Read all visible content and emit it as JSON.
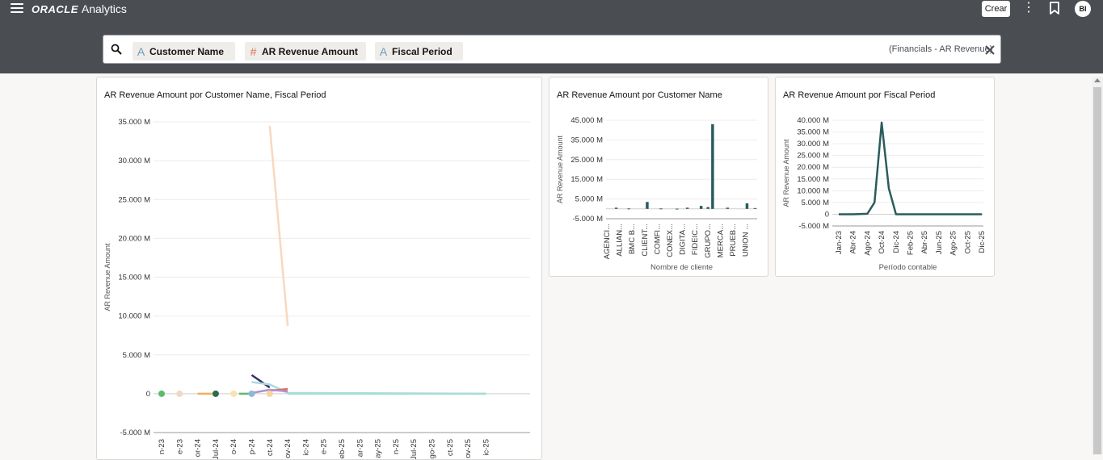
{
  "header": {
    "brand_oracle": "ORACLE",
    "brand_product": "Analytics",
    "create_label": "Crear",
    "kebab_symbol": "⋮",
    "avatar_initials": "BI"
  },
  "search": {
    "pills": [
      {
        "type_symbol": "A",
        "label": "Customer Name"
      },
      {
        "type_symbol": "#",
        "label": "AR Revenue Amount"
      },
      {
        "type_symbol": "A",
        "label": "Fiscal Period"
      }
    ],
    "subject_area": "(Financials - AR Revenue)"
  },
  "chart_data": [
    {
      "type": "line",
      "title": "AR Revenue Amount por Customer Name, Fiscal Period",
      "ylabel": "AR Revenue Amount",
      "xlabel": "",
      "ylim": [
        -5000,
        35000
      ],
      "yticks": [
        {
          "value": -5000,
          "label": "-5.000 M"
        },
        {
          "value": 0,
          "label": "0"
        },
        {
          "value": 5000,
          "label": "5.000 M"
        },
        {
          "value": 10000,
          "label": "10.000 M"
        },
        {
          "value": 15000,
          "label": "15.000 M"
        },
        {
          "value": 20000,
          "label": "20.000 M"
        },
        {
          "value": 25000,
          "label": "25.000 M"
        },
        {
          "value": 30000,
          "label": "30.000 M"
        },
        {
          "value": 35000,
          "label": "35.000 M"
        }
      ],
      "x_tick_labels": [
        "n-23",
        "e-23",
        "or-24",
        "Jul-24",
        "o-24",
        "p-24",
        "ct-24",
        "ov-24",
        "ic-24",
        "e-25",
        "eb-25",
        "ar-25",
        "ay-25",
        "n-25",
        "Jul-25",
        "go-25",
        "ct-25",
        "ov-25",
        "ic-25"
      ],
      "series": [
        {
          "color": "#f9d8c0",
          "x": [
            6,
            7
          ],
          "values": [
            34500,
            8700
          ]
        },
        {
          "color": "#3a2f6b",
          "x": [
            5,
            6
          ],
          "values": [
            2400,
            800
          ]
        },
        {
          "color": "#a8dcd8",
          "x": [
            5,
            6,
            7,
            18
          ],
          "values": [
            1500,
            1200,
            100,
            0
          ]
        },
        {
          "color": "#d9715a",
          "x": [
            6,
            7
          ],
          "values": [
            400,
            600
          ]
        },
        {
          "color": "#b48fd1",
          "x": [
            5,
            6,
            7
          ],
          "values": [
            100,
            500,
            300
          ]
        },
        {
          "color": "#a8dcd8",
          "x": [
            7,
            18
          ],
          "values": [
            0,
            0
          ]
        }
      ],
      "markers": [
        {
          "color": "#5dbb6e",
          "x": 0,
          "value": 0
        },
        {
          "color": "#f0d9c9",
          "x": 1,
          "value": 0
        },
        {
          "color": "#2e6b4a",
          "x": 3,
          "value": 0
        },
        {
          "color": "#f9e2b0",
          "x": 4,
          "value": 0
        },
        {
          "color": "#8fb8d8",
          "x": 5,
          "value": 0
        },
        {
          "color": "#f5d59a",
          "x": 6,
          "value": 0
        }
      ],
      "segments": [
        {
          "color": "#f0b060",
          "x": [
            2,
            2.8
          ],
          "values": [
            0,
            0
          ]
        },
        {
          "color": "#5dbb6e",
          "x": [
            4.3,
            4.9
          ],
          "values": [
            0,
            0
          ]
        }
      ]
    },
    {
      "type": "bar",
      "title": "AR Revenue Amount por Customer Name",
      "ylabel": "AR Revenue Amount",
      "xlabel": "Nombre de cliente",
      "ylim": [
        -5000,
        45000
      ],
      "yticks": [
        {
          "value": -5000,
          "label": "-5.000 M"
        },
        {
          "value": 5000,
          "label": "5.000 M"
        },
        {
          "value": 15000,
          "label": "15.000 M"
        },
        {
          "value": 25000,
          "label": "25.000 M"
        },
        {
          "value": 35000,
          "label": "35.000 M"
        },
        {
          "value": 45000,
          "label": "45.000 M"
        }
      ],
      "category_labels": [
        "AGENCI...",
        "ALLIAN...",
        "BMC B...",
        "CLIENT...",
        "COMFI...",
        "CONEX...",
        "DIGITA...",
        "FIDEIC...",
        "GRUPO...",
        "MERCA...",
        "PRUEB...",
        "UNION ..."
      ],
      "bar_x": [
        0.2,
        1.3,
        2.9,
        4.1,
        5.5,
        6.4,
        7.6,
        8.2,
        8.6,
        9.9,
        11.6,
        12.3
      ],
      "values": [
        600,
        200,
        3500,
        200,
        100,
        600,
        1500,
        900,
        43000,
        600,
        2800,
        400
      ],
      "color": "#2b5c5c"
    },
    {
      "type": "line",
      "title": "AR Revenue Amount por Fiscal Period",
      "ylabel": "AR Revenue Amount",
      "xlabel": "Período contable",
      "ylim": [
        -5000,
        40000
      ],
      "yticks": [
        {
          "value": -5000,
          "label": "-5.000 M"
        },
        {
          "value": 0,
          "label": "0"
        },
        {
          "value": 5000,
          "label": "5.000 M"
        },
        {
          "value": 10000,
          "label": "10.000 M"
        },
        {
          "value": 15000,
          "label": "15.000 M"
        },
        {
          "value": 20000,
          "label": "20.000 M"
        },
        {
          "value": 25000,
          "label": "25.000 M"
        },
        {
          "value": 30000,
          "label": "30.000 M"
        },
        {
          "value": 35000,
          "label": "35.000 M"
        },
        {
          "value": 40000,
          "label": "40.000 M"
        }
      ],
      "x_tick_labels": [
        "Jan-23",
        "Abr-24",
        "Ago-24",
        "Oct-24",
        "Dic-24",
        "Feb-25",
        "Abr-25",
        "Jun-25",
        "Ago-25",
        "Oct-25",
        "Dic-25"
      ],
      "x": [
        0,
        1,
        2,
        2.5,
        3,
        3.5,
        4,
        5,
        6,
        7,
        8,
        9,
        10
      ],
      "values": [
        0,
        0,
        200,
        5000,
        39000,
        11000,
        0,
        0,
        0,
        0,
        0,
        0,
        0
      ],
      "color": "#2b5c5c"
    }
  ]
}
